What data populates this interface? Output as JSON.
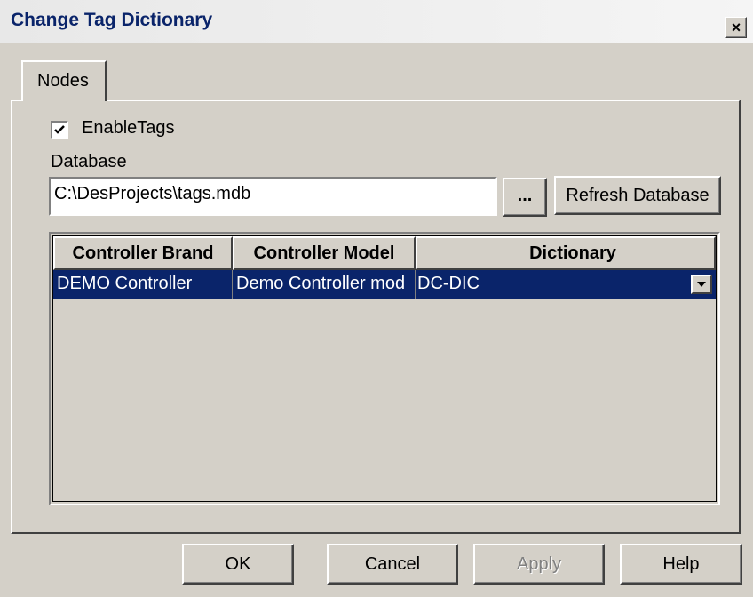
{
  "window": {
    "title": "Change Tag Dictionary",
    "close_label": "×"
  },
  "tabs": [
    {
      "label": "Nodes"
    }
  ],
  "enable_tags": {
    "label": "EnableTags",
    "checked": true
  },
  "database": {
    "label": "Database",
    "value": "C:\\DesProjects\\tags.mdb",
    "browse_label": "...",
    "refresh_label": "Refresh Database"
  },
  "grid": {
    "columns": [
      "Controller Brand",
      "Controller Model",
      "Dictionary"
    ],
    "rows": [
      {
        "brand": "DEMO Controller",
        "model": "Demo Controller mod",
        "dictionary": "DC-DIC"
      }
    ]
  },
  "buttons": {
    "ok": "OK",
    "cancel": "Cancel",
    "apply": "Apply",
    "help": "Help"
  },
  "colors": {
    "selection": "#0a246a",
    "face": "#d4d0c8"
  }
}
